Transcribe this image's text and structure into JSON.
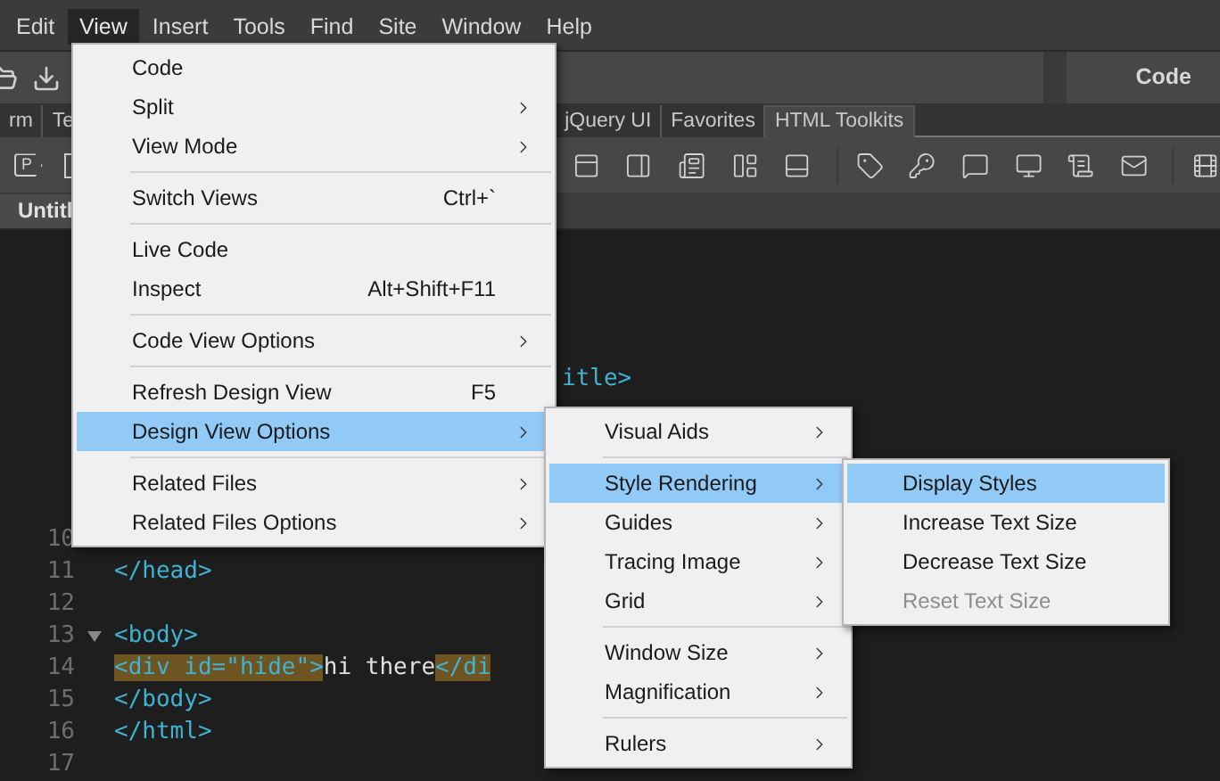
{
  "menubar": [
    {
      "label": "Edit",
      "selected": false
    },
    {
      "label": "View",
      "selected": true
    },
    {
      "label": "Insert",
      "selected": false
    },
    {
      "label": "Tools",
      "selected": false
    },
    {
      "label": "Find",
      "selected": false
    },
    {
      "label": "Site",
      "selected": false
    },
    {
      "label": "Window",
      "selected": false
    },
    {
      "label": "Help",
      "selected": false
    }
  ],
  "view_switch": {
    "label": "Code"
  },
  "insert_tabs": [
    {
      "label": "rm",
      "selected": false
    },
    {
      "label": "Te",
      "selected": false
    },
    {
      "label": "jQuery UI",
      "selected": false
    },
    {
      "label": "Favorites",
      "selected": false
    },
    {
      "label": "HTML Toolkits",
      "selected": true
    }
  ],
  "paragraph_button": {
    "label": "P"
  },
  "document_tab": {
    "label": "Untitl"
  },
  "code_lines": [
    {
      "kind": "empty"
    },
    {
      "kind": "empty"
    },
    {
      "kind": "empty"
    },
    {
      "kind": "empty"
    },
    {
      "kind": "fragment",
      "segments": [
        {
          "text": "itle>",
          "kind": "tag",
          "highlighted": false
        }
      ]
    },
    {
      "kind": "empty"
    },
    {
      "kind": "empty"
    },
    {
      "kind": "empty"
    },
    {
      "kind": "empty"
    },
    {
      "number": "10",
      "kind": "empty"
    },
    {
      "number": "11",
      "kind": "code",
      "segments": [
        {
          "text": "</head>",
          "kind": "tag",
          "highlighted": false
        }
      ]
    },
    {
      "number": "12",
      "kind": "empty"
    },
    {
      "number": "13",
      "kind": "code",
      "foldable": true,
      "segments": [
        {
          "text": "<body>",
          "kind": "tag",
          "highlighted": false
        }
      ]
    },
    {
      "number": "14",
      "kind": "code",
      "segments": [
        {
          "text": "<div id=\"hide\">",
          "kind": "tag",
          "highlighted": true
        },
        {
          "text": "hi there",
          "kind": "text",
          "highlighted": false
        },
        {
          "text": "</di",
          "kind": "tag",
          "highlighted": true
        }
      ]
    },
    {
      "number": "15",
      "kind": "code",
      "segments": [
        {
          "text": "</body>",
          "kind": "tag",
          "highlighted": false
        }
      ]
    },
    {
      "number": "16",
      "kind": "code",
      "segments": [
        {
          "text": "</html>",
          "kind": "tag",
          "highlighted": false
        }
      ]
    },
    {
      "number": "17",
      "kind": "empty"
    }
  ],
  "view_menu": [
    {
      "kind": "item",
      "label": "Code",
      "submenu": false,
      "selected": false,
      "disabled": false
    },
    {
      "kind": "item",
      "label": "Split",
      "submenu": true,
      "selected": false,
      "disabled": false
    },
    {
      "kind": "item",
      "label": "View Mode",
      "submenu": true,
      "selected": false,
      "disabled": false
    },
    {
      "kind": "separator"
    },
    {
      "kind": "item",
      "label": "Switch Views",
      "shortcut": "Ctrl+`",
      "submenu": false,
      "selected": false,
      "disabled": false
    },
    {
      "kind": "separator"
    },
    {
      "kind": "item",
      "label": "Live Code",
      "submenu": false,
      "selected": false,
      "disabled": false
    },
    {
      "kind": "item",
      "label": "Inspect",
      "shortcut": "Alt+Shift+F11",
      "submenu": false,
      "selected": false,
      "disabled": false
    },
    {
      "kind": "separator"
    },
    {
      "kind": "item",
      "label": "Code View Options",
      "submenu": true,
      "selected": false,
      "disabled": false
    },
    {
      "kind": "separator"
    },
    {
      "kind": "item",
      "label": "Refresh Design View",
      "shortcut": "F5",
      "submenu": false,
      "selected": false,
      "disabled": false
    },
    {
      "kind": "item",
      "label": "Design View Options",
      "submenu": true,
      "selected": true,
      "disabled": false
    },
    {
      "kind": "separator"
    },
    {
      "kind": "item",
      "label": "Related Files",
      "submenu": true,
      "selected": false,
      "disabled": false
    },
    {
      "kind": "item",
      "label": "Related Files Options",
      "submenu": true,
      "selected": false,
      "disabled": false
    }
  ],
  "design_view_options_menu": [
    {
      "kind": "item",
      "label": "Visual Aids",
      "submenu": true,
      "selected": false,
      "disabled": false
    },
    {
      "kind": "separator"
    },
    {
      "kind": "item",
      "label": "Style Rendering",
      "submenu": true,
      "selected": true,
      "disabled": false
    },
    {
      "kind": "item",
      "label": "Guides",
      "submenu": true,
      "selected": false,
      "disabled": false
    },
    {
      "kind": "item",
      "label": "Tracing Image",
      "submenu": true,
      "selected": false,
      "disabled": false
    },
    {
      "kind": "item",
      "label": "Grid",
      "submenu": true,
      "selected": false,
      "disabled": false
    },
    {
      "kind": "separator"
    },
    {
      "kind": "item",
      "label": "Window Size",
      "submenu": true,
      "selected": false,
      "disabled": false
    },
    {
      "kind": "item",
      "label": "Magnification",
      "submenu": true,
      "selected": false,
      "disabled": false
    },
    {
      "kind": "separator"
    },
    {
      "kind": "item",
      "label": "Rulers",
      "submenu": true,
      "selected": false,
      "disabled": false
    }
  ],
  "style_rendering_menu": [
    {
      "kind": "item",
      "label": "Display Styles",
      "submenu": false,
      "selected": true,
      "disabled": false
    },
    {
      "kind": "item",
      "label": "Increase Text Size",
      "submenu": false,
      "selected": false,
      "disabled": false
    },
    {
      "kind": "item",
      "label": "Decrease Text Size",
      "submenu": false,
      "selected": false,
      "disabled": false
    },
    {
      "kind": "item",
      "label": "Reset Text Size",
      "submenu": false,
      "selected": false,
      "disabled": true
    }
  ]
}
